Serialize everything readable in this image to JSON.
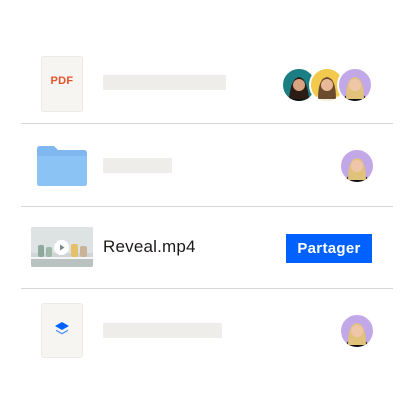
{
  "files": [
    {
      "type": "pdf",
      "icon_label": "PDF",
      "icon": "pdf-file-icon",
      "avatars": [
        "person-1",
        "person-2",
        "person-3"
      ]
    },
    {
      "type": "folder",
      "icon": "folder-icon",
      "avatars": [
        "person-3"
      ]
    },
    {
      "type": "video",
      "name": "Reveal.mp4",
      "icon": "play-icon",
      "action_label": "Partager",
      "avatars": []
    },
    {
      "type": "dropbox",
      "icon": "dropbox-logo-icon",
      "avatars": [
        "person-3"
      ]
    }
  ],
  "colors": {
    "accent": "#0061fe",
    "pdf_text": "#e7512b",
    "folder": "#8cc3f5",
    "avatar_teal": "#1b7e82",
    "avatar_yellow": "#f2c94c",
    "avatar_purple": "#c3a8e8",
    "placeholder": "#efedea",
    "divider": "#d7d7d7"
  }
}
